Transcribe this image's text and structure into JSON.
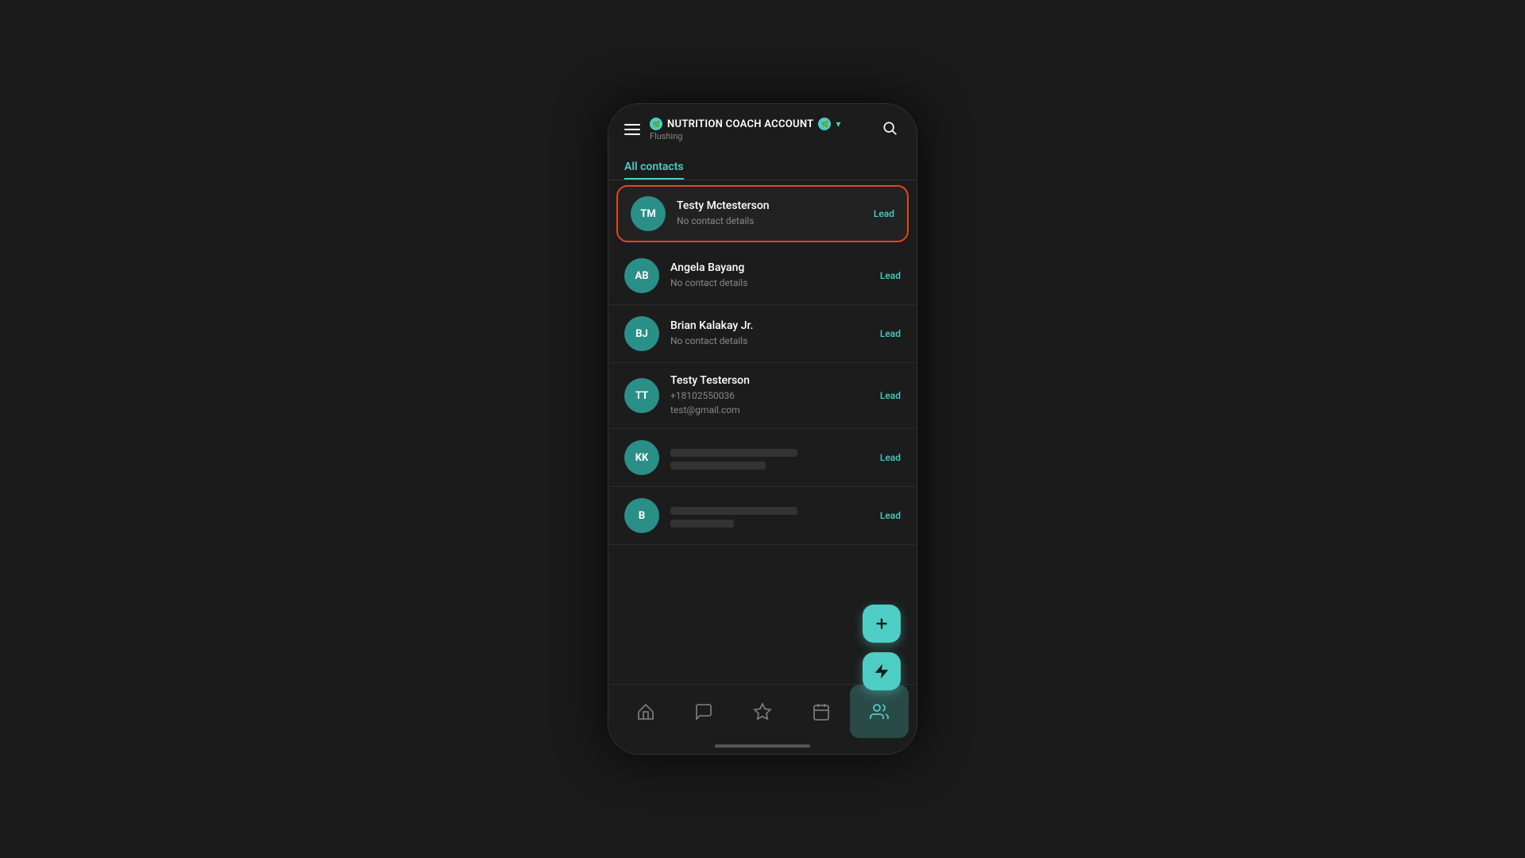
{
  "header": {
    "menu_label": "menu",
    "account_name": "NUTRITION COACH ACCOUNT",
    "location": "Flushing",
    "dropdown_label": "dropdown",
    "search_label": "search"
  },
  "section": {
    "title": "All contacts"
  },
  "contacts": [
    {
      "id": 1,
      "initials": "TM",
      "name": "Testy Mctesterson",
      "detail1": "No contact details",
      "detail2": "",
      "badge": "Lead",
      "highlighted": true
    },
    {
      "id": 2,
      "initials": "AB",
      "name": "Angela Bayang",
      "detail1": "No contact details",
      "detail2": "",
      "badge": "Lead",
      "highlighted": false
    },
    {
      "id": 3,
      "initials": "BJ",
      "name": "Brian Kalakay Jr.",
      "detail1": "No contact details",
      "detail2": "",
      "badge": "Lead",
      "highlighted": false
    },
    {
      "id": 4,
      "initials": "TT",
      "name": "Testy Testerson",
      "detail1": "+18102550036",
      "detail2": "test@gmail.com",
      "badge": "Lead",
      "highlighted": false
    },
    {
      "id": 5,
      "initials": "KK",
      "name": "",
      "detail1": "",
      "detail2": "",
      "badge": "Lead",
      "highlighted": false,
      "redacted": true
    },
    {
      "id": 6,
      "initials": "B",
      "name": "",
      "detail1": "",
      "detail2": "",
      "badge": "Lead",
      "highlighted": false,
      "redacted": true
    }
  ],
  "fab": {
    "add_label": "add contact",
    "lightning_label": "quick action"
  },
  "nav": {
    "items": [
      {
        "label": "home",
        "icon": "home",
        "active": false
      },
      {
        "label": "messages",
        "icon": "chat",
        "active": false
      },
      {
        "label": "favorites",
        "icon": "star",
        "active": false
      },
      {
        "label": "calendar",
        "icon": "calendar",
        "active": false
      },
      {
        "label": "contacts",
        "icon": "contacts",
        "active": true
      }
    ]
  }
}
